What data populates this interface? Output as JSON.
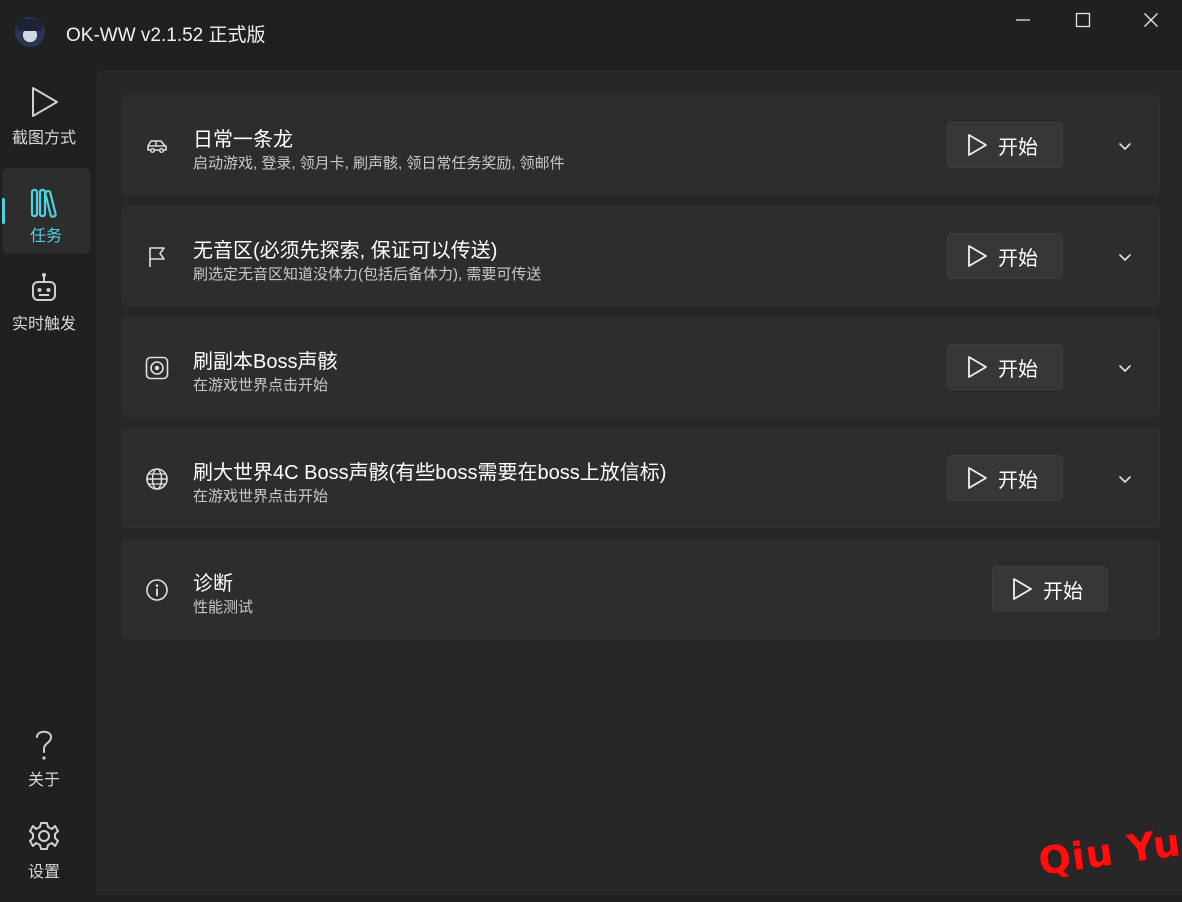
{
  "window": {
    "title": "OK-WW v2.1.52 正式版",
    "controls": [
      "minimize-icon",
      "maximize-icon",
      "close-icon"
    ]
  },
  "sidebar": {
    "top_items": [
      {
        "label": "截图方式",
        "icon": "play-icon",
        "active": false
      },
      {
        "label": "任务",
        "icon": "library-icon",
        "active": true
      },
      {
        "label": "实时触发",
        "icon": "robot-icon",
        "active": false
      }
    ],
    "bottom_items": [
      {
        "label": "关于",
        "icon": "question-icon"
      },
      {
        "label": "设置",
        "icon": "gear-icon"
      }
    ]
  },
  "tasks": [
    {
      "title": "日常一条龙",
      "subtitle": "启动游戏, 登录, 领月卡, 刷声骸, 领日常任务奖励, 领邮件",
      "icon": "car-icon",
      "button": "开始",
      "expandable": true
    },
    {
      "title": "无音区(必须先探索, 保证可以传送)",
      "subtitle": "刷选定无音区知道没体力(包括后备体力), 需要可传送",
      "icon": "flag-icon",
      "button": "开始",
      "expandable": true
    },
    {
      "title": "刷副本Boss声骸",
      "subtitle": "在游戏世界点击开始",
      "icon": "target-icon",
      "button": "开始",
      "expandable": true
    },
    {
      "title": "刷大世界4C Boss声骸(有些boss需要在boss上放信标)",
      "subtitle": "在游戏世界点击开始",
      "icon": "globe-icon",
      "button": "开始",
      "expandable": true
    },
    {
      "title": "诊断",
      "subtitle": "性能测试",
      "icon": "info-icon",
      "button": "开始",
      "expandable": false
    }
  ],
  "watermark": "Qiu  Yue",
  "colors": {
    "accent": "#4fd1e0",
    "background": "#202020",
    "card": "#2d2d2d",
    "button": "#373737",
    "watermark": "#ff1010"
  }
}
